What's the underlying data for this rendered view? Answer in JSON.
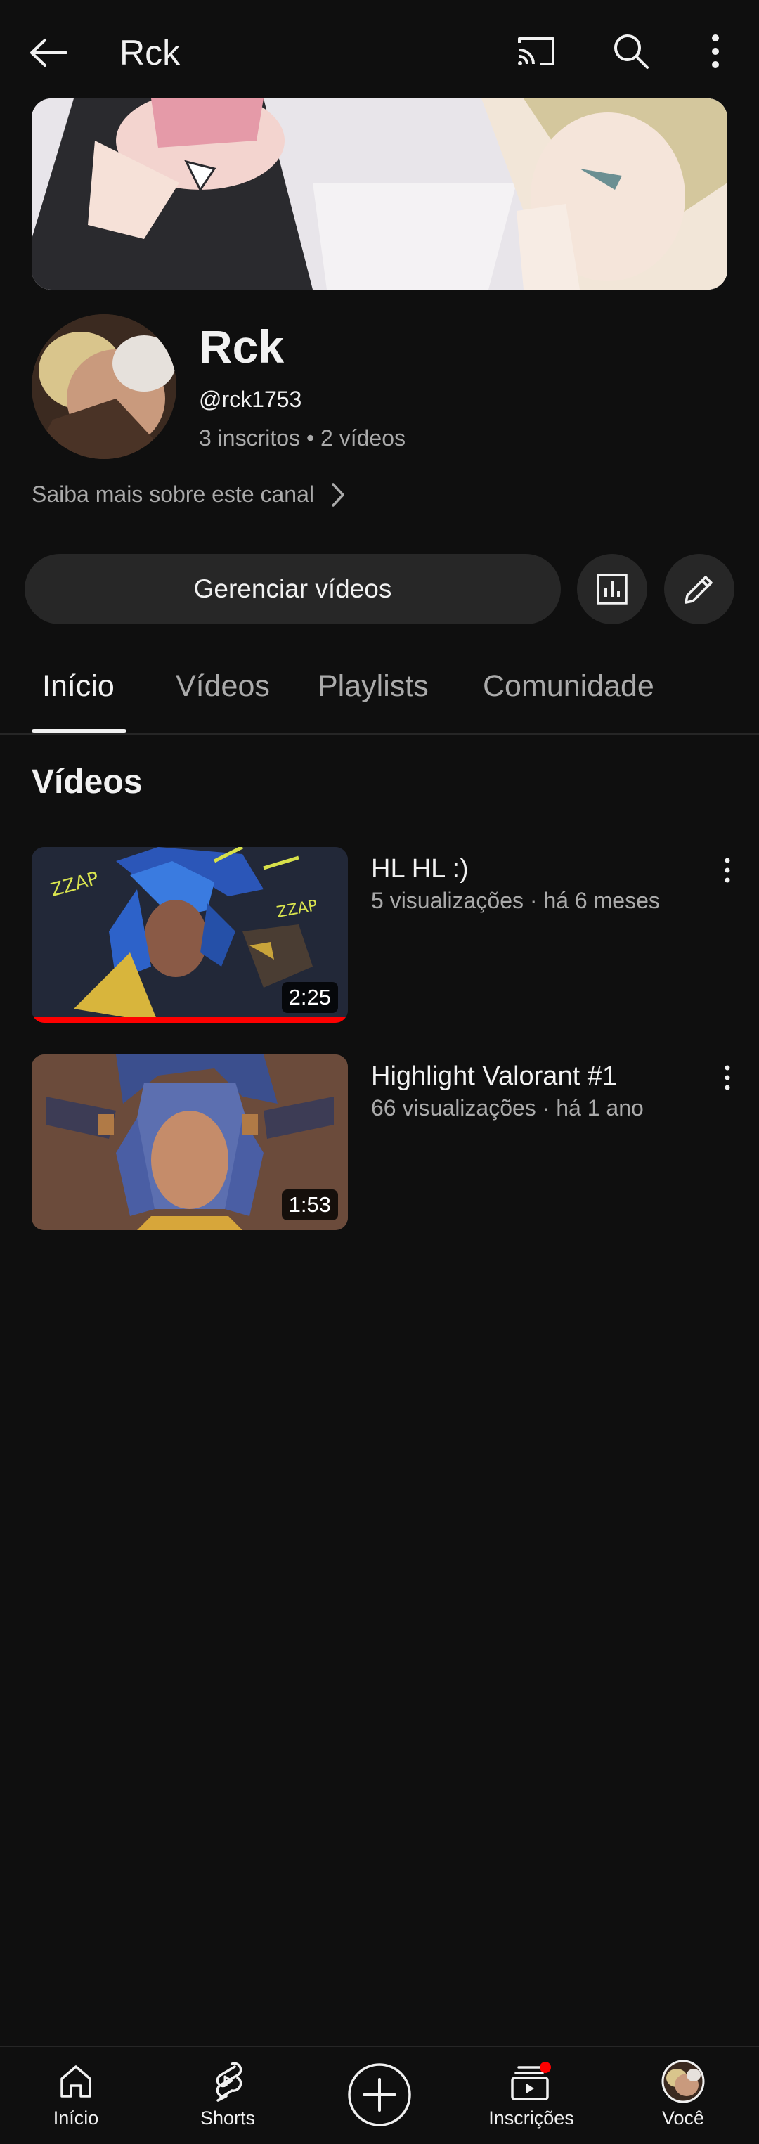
{
  "header": {
    "title": "Rck",
    "icons": [
      "back-arrow-icon",
      "cast-icon",
      "search-icon",
      "more-vert-icon"
    ]
  },
  "channel": {
    "name": "Rck",
    "handle": "@rck1753",
    "stats": "3 inscritos • 2 vídeos",
    "learn_more": "Saiba mais sobre este canal"
  },
  "actions": {
    "manage_label": "Gerenciar vídeos",
    "icons": [
      "analytics-icon",
      "edit-pencil-icon"
    ]
  },
  "tabs": [
    {
      "label": "Início",
      "active": true
    },
    {
      "label": "Vídeos",
      "active": false
    },
    {
      "label": "Playlists",
      "active": false
    },
    {
      "label": "Comunidade",
      "active": false
    }
  ],
  "section_title": "Vídeos",
  "videos": [
    {
      "title": "HL HL :)",
      "meta": "5 visualizações · há 6 meses",
      "duration": "2:25",
      "watched": true
    },
    {
      "title": "Highlight Valorant #1",
      "meta": "66 visualizações · há 1 ano",
      "duration": "1:53",
      "watched": false
    }
  ],
  "bottom_nav": [
    {
      "label": "Início",
      "icon": "home-icon"
    },
    {
      "label": "Shorts",
      "icon": "shorts-icon"
    },
    {
      "label": "",
      "icon": "create-plus-icon"
    },
    {
      "label": "Inscrições",
      "icon": "subscriptions-icon"
    },
    {
      "label": "Você",
      "icon": "avatar-icon"
    }
  ],
  "colors": {
    "background": "#0f0f0f",
    "surface": "#272727",
    "text_primary": "#f1f1f1",
    "text_secondary": "#aaaaaa",
    "accent_red": "#ff0000"
  }
}
